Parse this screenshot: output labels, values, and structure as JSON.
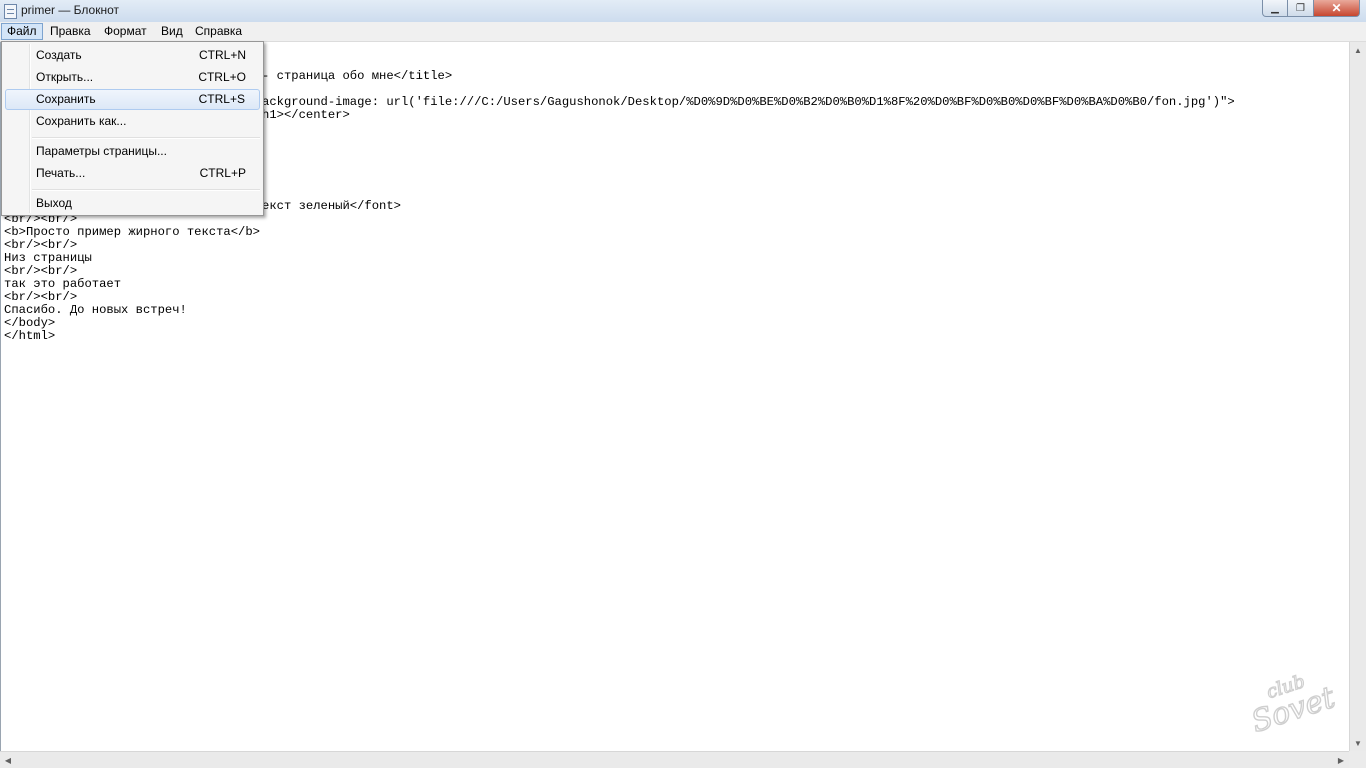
{
  "window": {
    "title": "primer — Блокнот",
    "min_symbol": "▁",
    "max_symbol": "❐",
    "close_symbol": "✕"
  },
  "menu": {
    "file": "Файл",
    "edit": "Правка",
    "format": "Формат",
    "view": "Вид",
    "help": "Справка"
  },
  "file_menu": {
    "new": {
      "label": "Создать",
      "shortcut": "CTRL+N"
    },
    "open": {
      "label": "Открыть...",
      "shortcut": "CTRL+O"
    },
    "save": {
      "label": "Сохранить",
      "shortcut": "CTRL+S"
    },
    "save_as": {
      "label": "Сохранить как..."
    },
    "page_setup": {
      "label": "Параметры страницы..."
    },
    "print": {
      "label": "Печать...",
      "shortcut": "CTRL+P"
    },
    "exit": {
      "label": "Выход"
    }
  },
  "document": {
    "visible_fragments": [
      "- страница обо мне</title>",
      "ackground-image: url('file:///C:/Users/Gagushonok/Desktop/%D0%9D%D0%BE%D0%B2%D0%B0%D1%8F%20%D0%BF%D0%B0%D0%BF%D0%BA%D0%B0/fon.jpg')\">",
      "h1></center>",
      "екст зеленый</font>"
    ],
    "lines": [
      "<br/><br/>",
      "<b>Просто пример жирного текста</b>",
      "<br/><br/>",
      "Низ страницы",
      "<br/><br/>",
      "так это работает",
      "<br/><br/>",
      "Спасибо. До новых встреч!",
      "</body>",
      "</html>"
    ]
  },
  "watermark": {
    "text": "club Sovet"
  },
  "scrollbar": {
    "up": "▲",
    "down": "▼",
    "left": "◀",
    "right": "▶"
  }
}
